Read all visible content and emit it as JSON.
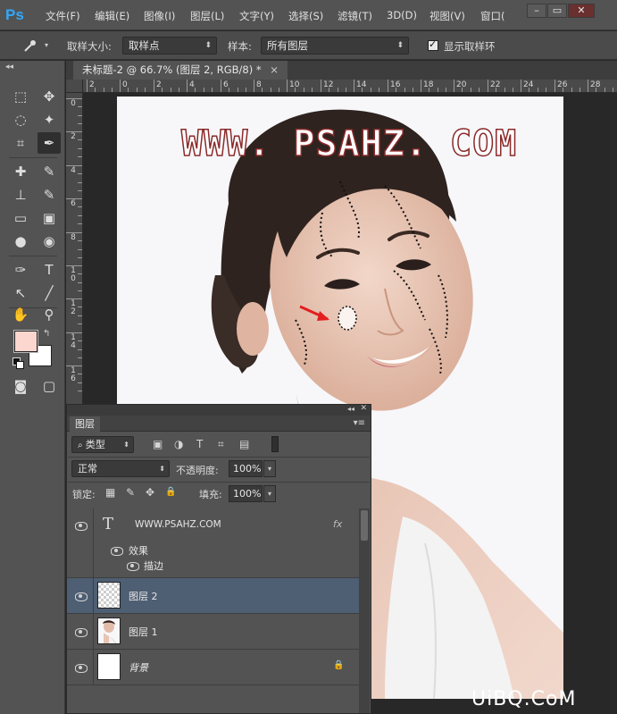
{
  "app": {
    "logo": "Ps"
  },
  "menu": {
    "items": [
      "文件(F)",
      "编辑(E)",
      "图像(I)",
      "图层(L)",
      "文字(Y)",
      "选择(S)",
      "滤镜(T)",
      "3D(D)",
      "视图(V)",
      "窗口("
    ],
    "win_minimize": "–",
    "win_restore": "▭",
    "win_close": "✕"
  },
  "options": {
    "sample_size_label": "取样大小:",
    "sample_size_value": "取样点",
    "sample_label": "样本:",
    "sample_value": "所有图层",
    "show_ring_label": "显示取样环"
  },
  "tools": {
    "collapse": "◂◂",
    "swap": "↰",
    "glyphs": [
      "⬚",
      "✥",
      "◌",
      "✦",
      "⌗",
      "✒",
      "✚",
      "✎",
      "⊥",
      "✎",
      "▭",
      "▣",
      "●",
      "◉",
      "✑",
      "T",
      "↖",
      "╱",
      "✋",
      "⚲",
      "◙",
      "▢"
    ]
  },
  "document": {
    "tab_title": "未标题-2 @ 66.7% (图层 2, RGB/8) *",
    "close": "×"
  },
  "rulers": {
    "top_labels": [
      "2",
      "0",
      "2",
      "4",
      "6",
      "8",
      "10",
      "12",
      "14",
      "16",
      "18",
      "20",
      "22",
      "24",
      "26",
      "28"
    ],
    "left_labels": [
      "0",
      "2",
      "4",
      "6",
      "8",
      "1\n0",
      "1\n2",
      "1\n4",
      "1\n6"
    ]
  },
  "canvas": {
    "watermark_text": "WWW. PSAHZ. COM",
    "colors": {
      "skin": "#e9c9b8",
      "hair": "#2b201c",
      "lips": "#c96b7a",
      "dress": "#f2f2f2",
      "arrow": "#e21e1e"
    }
  },
  "layers_panel": {
    "tab_label": "图层",
    "collapse": "◂◂",
    "close": "✕",
    "menu": "▾≡",
    "filter_kind": "类型",
    "filter_icons": [
      "▣",
      "◑",
      "T",
      "⌗",
      "▤"
    ],
    "blend_mode": "正常",
    "opacity_label": "不透明度:",
    "opacity_value": "100%",
    "lock_label": "锁定:",
    "lock_icons": [
      "▦",
      "✎",
      "✥",
      "🔒"
    ],
    "fill_label": "填充:",
    "fill_value": "100%",
    "layers": [
      {
        "name": "WWW.PSAHZ.COM",
        "type": "text",
        "fx": "fx",
        "effects_label": "效果",
        "effect_stroke": "描边"
      },
      {
        "name": "图层 2",
        "type": "transparent",
        "selected": true
      },
      {
        "name": "图层 1",
        "type": "photo"
      },
      {
        "name": "背景",
        "type": "background",
        "lock": "🔒"
      }
    ]
  },
  "site_watermark": "UiBQ.CoM"
}
